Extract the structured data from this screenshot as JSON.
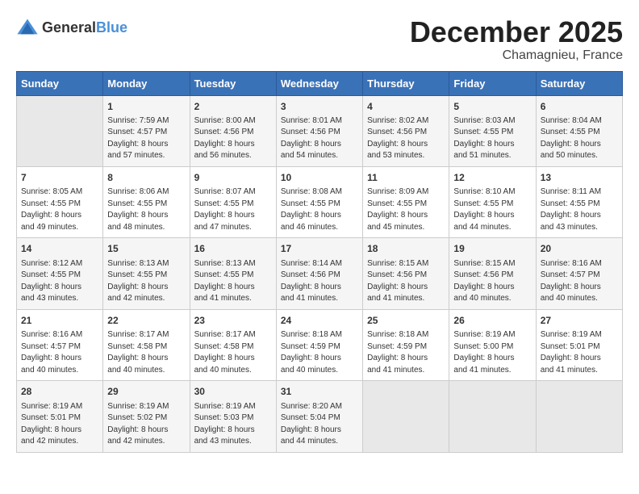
{
  "logo": {
    "general": "General",
    "blue": "Blue"
  },
  "title": "December 2025",
  "location": "Chamagnieu, France",
  "days_header": [
    "Sunday",
    "Monday",
    "Tuesday",
    "Wednesday",
    "Thursday",
    "Friday",
    "Saturday"
  ],
  "weeks": [
    [
      {
        "day": "",
        "info": ""
      },
      {
        "day": "1",
        "info": "Sunrise: 7:59 AM\nSunset: 4:57 PM\nDaylight: 8 hours\nand 57 minutes."
      },
      {
        "day": "2",
        "info": "Sunrise: 8:00 AM\nSunset: 4:56 PM\nDaylight: 8 hours\nand 56 minutes."
      },
      {
        "day": "3",
        "info": "Sunrise: 8:01 AM\nSunset: 4:56 PM\nDaylight: 8 hours\nand 54 minutes."
      },
      {
        "day": "4",
        "info": "Sunrise: 8:02 AM\nSunset: 4:56 PM\nDaylight: 8 hours\nand 53 minutes."
      },
      {
        "day": "5",
        "info": "Sunrise: 8:03 AM\nSunset: 4:55 PM\nDaylight: 8 hours\nand 51 minutes."
      },
      {
        "day": "6",
        "info": "Sunrise: 8:04 AM\nSunset: 4:55 PM\nDaylight: 8 hours\nand 50 minutes."
      }
    ],
    [
      {
        "day": "7",
        "info": "Sunrise: 8:05 AM\nSunset: 4:55 PM\nDaylight: 8 hours\nand 49 minutes."
      },
      {
        "day": "8",
        "info": "Sunrise: 8:06 AM\nSunset: 4:55 PM\nDaylight: 8 hours\nand 48 minutes."
      },
      {
        "day": "9",
        "info": "Sunrise: 8:07 AM\nSunset: 4:55 PM\nDaylight: 8 hours\nand 47 minutes."
      },
      {
        "day": "10",
        "info": "Sunrise: 8:08 AM\nSunset: 4:55 PM\nDaylight: 8 hours\nand 46 minutes."
      },
      {
        "day": "11",
        "info": "Sunrise: 8:09 AM\nSunset: 4:55 PM\nDaylight: 8 hours\nand 45 minutes."
      },
      {
        "day": "12",
        "info": "Sunrise: 8:10 AM\nSunset: 4:55 PM\nDaylight: 8 hours\nand 44 minutes."
      },
      {
        "day": "13",
        "info": "Sunrise: 8:11 AM\nSunset: 4:55 PM\nDaylight: 8 hours\nand 43 minutes."
      }
    ],
    [
      {
        "day": "14",
        "info": "Sunrise: 8:12 AM\nSunset: 4:55 PM\nDaylight: 8 hours\nand 43 minutes."
      },
      {
        "day": "15",
        "info": "Sunrise: 8:13 AM\nSunset: 4:55 PM\nDaylight: 8 hours\nand 42 minutes."
      },
      {
        "day": "16",
        "info": "Sunrise: 8:13 AM\nSunset: 4:55 PM\nDaylight: 8 hours\nand 41 minutes."
      },
      {
        "day": "17",
        "info": "Sunrise: 8:14 AM\nSunset: 4:56 PM\nDaylight: 8 hours\nand 41 minutes."
      },
      {
        "day": "18",
        "info": "Sunrise: 8:15 AM\nSunset: 4:56 PM\nDaylight: 8 hours\nand 41 minutes."
      },
      {
        "day": "19",
        "info": "Sunrise: 8:15 AM\nSunset: 4:56 PM\nDaylight: 8 hours\nand 40 minutes."
      },
      {
        "day": "20",
        "info": "Sunrise: 8:16 AM\nSunset: 4:57 PM\nDaylight: 8 hours\nand 40 minutes."
      }
    ],
    [
      {
        "day": "21",
        "info": "Sunrise: 8:16 AM\nSunset: 4:57 PM\nDaylight: 8 hours\nand 40 minutes."
      },
      {
        "day": "22",
        "info": "Sunrise: 8:17 AM\nSunset: 4:58 PM\nDaylight: 8 hours\nand 40 minutes."
      },
      {
        "day": "23",
        "info": "Sunrise: 8:17 AM\nSunset: 4:58 PM\nDaylight: 8 hours\nand 40 minutes."
      },
      {
        "day": "24",
        "info": "Sunrise: 8:18 AM\nSunset: 4:59 PM\nDaylight: 8 hours\nand 40 minutes."
      },
      {
        "day": "25",
        "info": "Sunrise: 8:18 AM\nSunset: 4:59 PM\nDaylight: 8 hours\nand 41 minutes."
      },
      {
        "day": "26",
        "info": "Sunrise: 8:19 AM\nSunset: 5:00 PM\nDaylight: 8 hours\nand 41 minutes."
      },
      {
        "day": "27",
        "info": "Sunrise: 8:19 AM\nSunset: 5:01 PM\nDaylight: 8 hours\nand 41 minutes."
      }
    ],
    [
      {
        "day": "28",
        "info": "Sunrise: 8:19 AM\nSunset: 5:01 PM\nDaylight: 8 hours\nand 42 minutes."
      },
      {
        "day": "29",
        "info": "Sunrise: 8:19 AM\nSunset: 5:02 PM\nDaylight: 8 hours\nand 42 minutes."
      },
      {
        "day": "30",
        "info": "Sunrise: 8:19 AM\nSunset: 5:03 PM\nDaylight: 8 hours\nand 43 minutes."
      },
      {
        "day": "31",
        "info": "Sunrise: 8:20 AM\nSunset: 5:04 PM\nDaylight: 8 hours\nand 44 minutes."
      },
      {
        "day": "",
        "info": ""
      },
      {
        "day": "",
        "info": ""
      },
      {
        "day": "",
        "info": ""
      }
    ]
  ]
}
